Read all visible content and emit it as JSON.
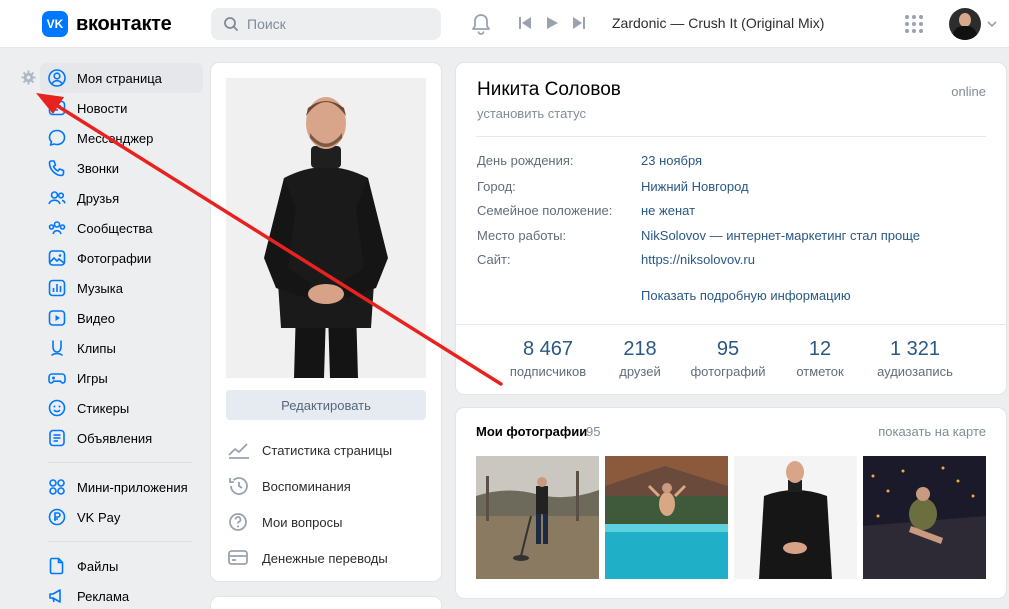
{
  "header": {
    "logo_mark": "VK",
    "logo_text": "вконтакте",
    "search_placeholder": "Поиск",
    "track": "Zardonic — Crush It (Original Mix)"
  },
  "nav": {
    "items": [
      {
        "label": "Моя страница",
        "icon": "user-circle-icon"
      },
      {
        "label": "Новости",
        "icon": "news-icon"
      },
      {
        "label": "Мессенджер",
        "icon": "message-icon"
      },
      {
        "label": "Звонки",
        "icon": "phone-icon"
      },
      {
        "label": "Друзья",
        "icon": "friends-icon"
      },
      {
        "label": "Сообщества",
        "icon": "communities-icon"
      },
      {
        "label": "Фотографии",
        "icon": "photos-icon"
      },
      {
        "label": "Музыка",
        "icon": "music-icon"
      },
      {
        "label": "Видео",
        "icon": "video-icon"
      },
      {
        "label": "Клипы",
        "icon": "clips-icon"
      },
      {
        "label": "Игры",
        "icon": "games-icon"
      },
      {
        "label": "Стикеры",
        "icon": "stickers-icon"
      },
      {
        "label": "Объявления",
        "icon": "ads-icon"
      }
    ],
    "items2": [
      {
        "label": "Мини-приложения",
        "icon": "mini-apps-icon"
      },
      {
        "label": "VK Pay",
        "icon": "vkpay-icon"
      }
    ],
    "items3": [
      {
        "label": "Файлы",
        "icon": "files-icon"
      },
      {
        "label": "Реклама",
        "icon": "advertising-icon"
      }
    ]
  },
  "left_card": {
    "edit_label": "Редактировать",
    "links": [
      {
        "label": "Статистика страницы",
        "icon": "stats-icon"
      },
      {
        "label": "Воспоминания",
        "icon": "memories-icon"
      },
      {
        "label": "Мои вопросы",
        "icon": "questions-icon"
      },
      {
        "label": "Денежные переводы",
        "icon": "money-transfer-icon"
      }
    ]
  },
  "profile": {
    "name": "Никита Соловов",
    "status": "установить статус",
    "online": "online",
    "info": [
      {
        "key": "День рождения:",
        "value": "23 ноября"
      },
      {
        "key": "Город:",
        "value": "Нижний Новгород"
      },
      {
        "key": "Семейное положение:",
        "value": "не женат"
      },
      {
        "key": "Место работы:",
        "value": "NikSolovov — интернет-маркетинг стал проще"
      },
      {
        "key": "Сайт:",
        "value": "https://niksolovov.ru"
      }
    ],
    "more_label": "Показать подробную информацию",
    "counters": [
      {
        "num": "8 467",
        "label": "подписчиков"
      },
      {
        "num": "218",
        "label": "друзей"
      },
      {
        "num": "95",
        "label": "фотографий"
      },
      {
        "num": "12",
        "label": "отметок"
      },
      {
        "num": "1 321",
        "label": "аудиозапись"
      }
    ]
  },
  "photos": {
    "title": "Мои фотографии",
    "count": "95",
    "map_label": "показать на карте"
  },
  "colors": {
    "accent": "#0077ff",
    "link": "#2a5885",
    "arrow": "#e8231f"
  }
}
